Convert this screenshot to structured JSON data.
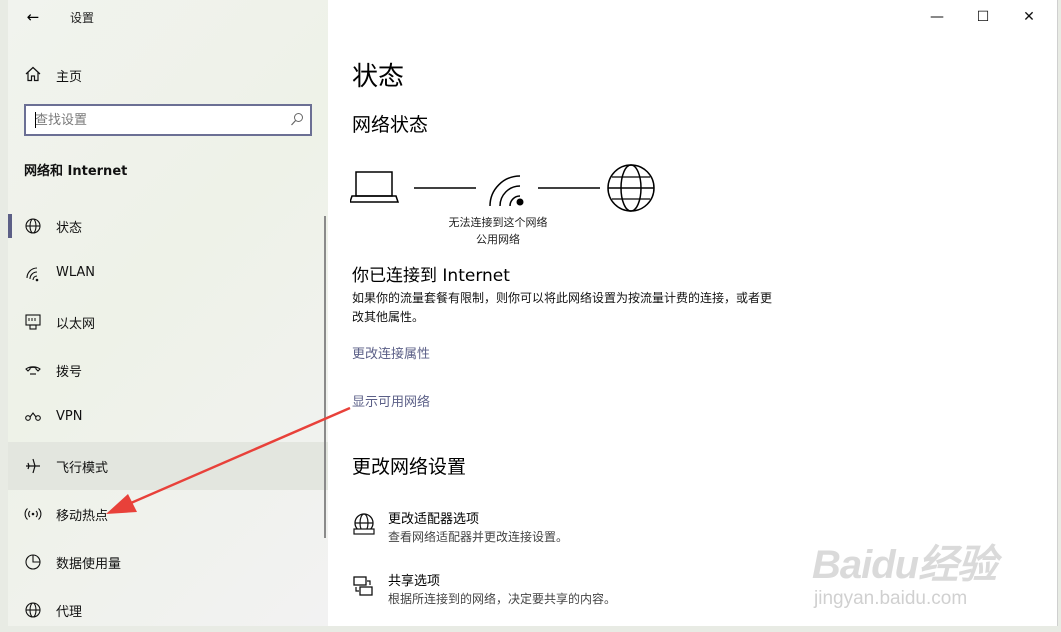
{
  "window": {
    "title": "设置"
  },
  "sidebar": {
    "home_label": "主页",
    "search_placeholder": "查找设置",
    "section_title": "网络和 Internet",
    "items": [
      {
        "label": "状态",
        "icon": "globe-icon",
        "selected": true
      },
      {
        "label": "WLAN",
        "icon": "wifi-icon"
      },
      {
        "label": "以太网",
        "icon": "ethernet-icon"
      },
      {
        "label": "拨号",
        "icon": "dialup-icon"
      },
      {
        "label": "VPN",
        "icon": "vpn-icon"
      },
      {
        "label": "飞行模式",
        "icon": "airplane-icon",
        "hover": true
      },
      {
        "label": "移动热点",
        "icon": "hotspot-icon"
      },
      {
        "label": "数据使用量",
        "icon": "data-usage-icon"
      },
      {
        "label": "代理",
        "icon": "globe-icon"
      }
    ]
  },
  "main": {
    "page_title": "状态",
    "network_status_heading": "网络状态",
    "diagram": {
      "caption_line1": "无法连接到这个网络",
      "caption_line2": "公用网络"
    },
    "connected_heading": "你已连接到 Internet",
    "connected_desc": "如果你的流量套餐有限制，则你可以将此网络设置为按流量计费的连接，或者更改其他属性。",
    "link_change_props": "更改连接属性",
    "link_show_networks": "显示可用网络",
    "change_settings_heading": "更改网络设置",
    "options": [
      {
        "title": "更改适配器选项",
        "subtitle": "查看网络适配器并更改连接设置。",
        "icon": "adapter-icon"
      },
      {
        "title": "共享选项",
        "subtitle": "根据所连接到的网络，决定要共享的内容。",
        "icon": "sharing-icon"
      }
    ]
  },
  "watermark": {
    "logo": "Baidu经验",
    "url": "jingyan.baidu.com"
  },
  "colors": {
    "accent": "#5c5f86",
    "link": "#5b5f87",
    "annotation_arrow": "#e8413a"
  }
}
